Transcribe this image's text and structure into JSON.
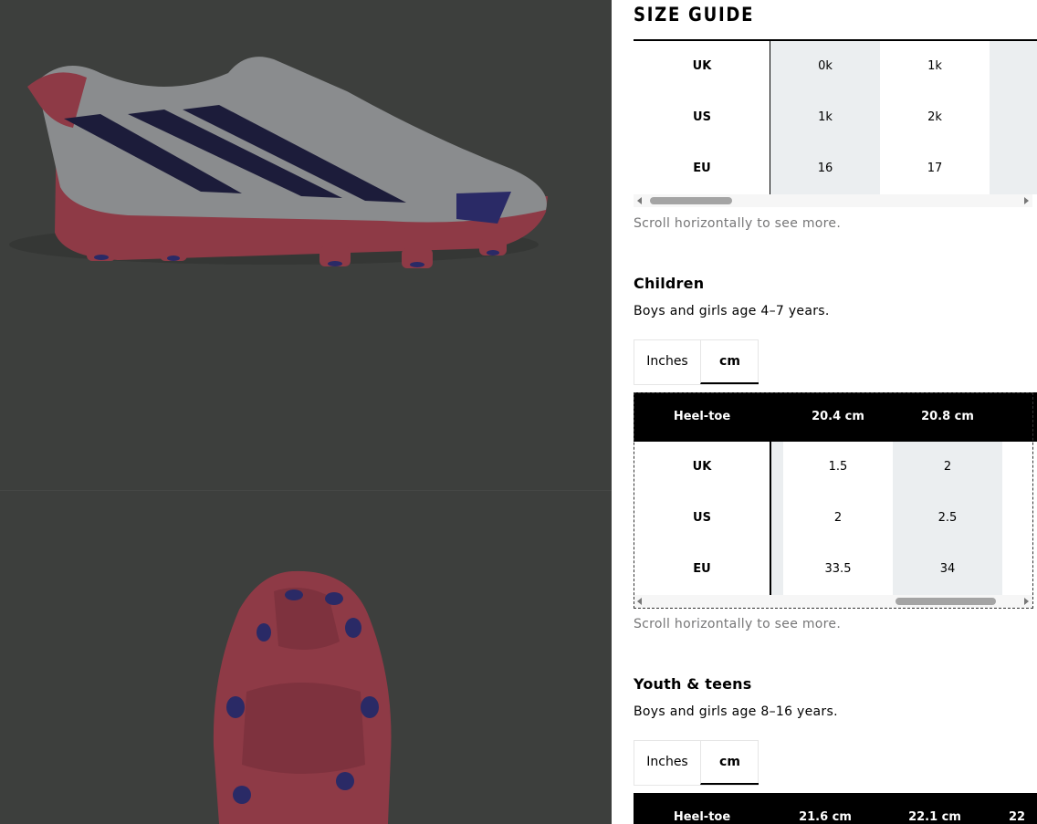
{
  "title": "SIZE GUIDE",
  "infant_table": {
    "rows": [
      {
        "label": "UK",
        "values": [
          "0k",
          "1k"
        ]
      },
      {
        "label": "US",
        "values": [
          "1k",
          "2k"
        ]
      },
      {
        "label": "EU",
        "values": [
          "16",
          "17"
        ]
      }
    ],
    "hint": "Scroll horizontally to see more.",
    "scroll_position": 0.0
  },
  "children": {
    "title": "Children",
    "description": "Boys and girls age 4–7 years.",
    "unit_toggle": {
      "inches": "Inches",
      "cm": "cm",
      "selected": "cm"
    },
    "header": [
      "Heel-toe",
      "20.4 cm",
      "20.8 cm"
    ],
    "rows": [
      {
        "label": "UK",
        "values": [
          "1.5",
          "2"
        ]
      },
      {
        "label": "US",
        "values": [
          "2",
          "2.5"
        ]
      },
      {
        "label": "EU",
        "values": [
          "33.5",
          "34"
        ]
      }
    ],
    "hint": "Scroll horizontally to see more.",
    "scroll_position": 0.78
  },
  "youth": {
    "title": "Youth & teens",
    "description": "Boys and girls age 8–16 years.",
    "unit_toggle": {
      "inches": "Inches",
      "cm": "cm",
      "selected": "cm"
    },
    "header": [
      "Heel-toe",
      "21.6 cm",
      "22.1 cm",
      "22"
    ]
  },
  "colors": {
    "overlay": "#3c3e3c",
    "shade": "#ebeef0",
    "hint": "#767677",
    "header_bg": "#000000"
  }
}
